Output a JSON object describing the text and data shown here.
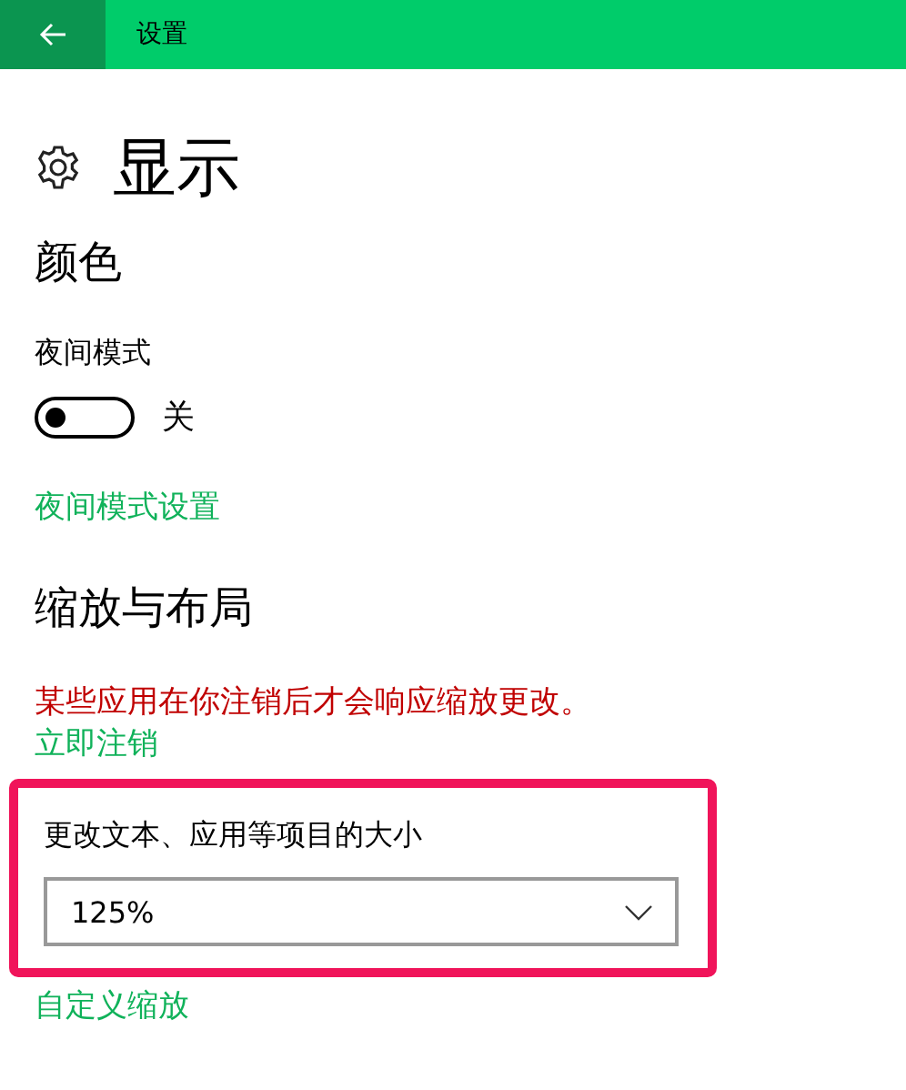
{
  "header": {
    "title": "设置"
  },
  "page": {
    "title": "显示"
  },
  "color_section": {
    "heading": "颜色",
    "night_mode": {
      "label": "夜间模式",
      "on": false,
      "state_text": "关"
    },
    "settings_link": "夜间模式设置"
  },
  "scale_section": {
    "heading": "缩放与布局",
    "warning": "某些应用在你注销后才会响应缩放更改。",
    "signout_link": "立即注销",
    "highlighted": true,
    "size_label": "更改文本、应用等项目的大小",
    "size_value": "125%",
    "custom_link": "自定义缩放"
  }
}
